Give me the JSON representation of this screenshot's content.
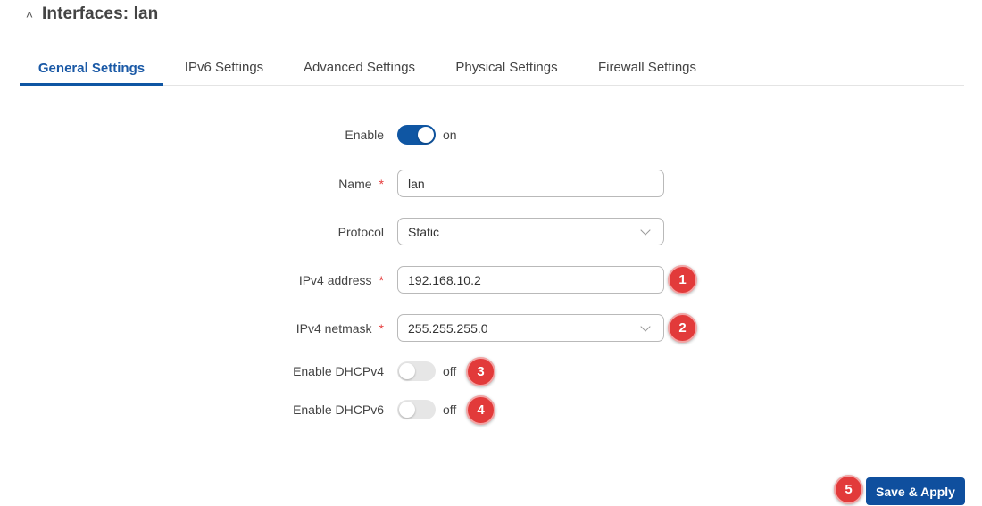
{
  "header": {
    "collapse_icon": "chevron-up-icon",
    "title": "Interfaces: lan"
  },
  "tabs": [
    {
      "label": "General Settings",
      "active": true
    },
    {
      "label": "IPv6 Settings",
      "active": false
    },
    {
      "label": "Advanced Settings",
      "active": false
    },
    {
      "label": "Physical Settings",
      "active": false
    },
    {
      "label": "Firewall Settings",
      "active": false
    }
  ],
  "form": {
    "enable": {
      "label": "Enable",
      "state": "on"
    },
    "name": {
      "label": "Name",
      "required_mark": "*",
      "value": "lan"
    },
    "protocol": {
      "label": "Protocol",
      "value": "Static"
    },
    "ipv4_address": {
      "label": "IPv4 address",
      "required_mark": "*",
      "value": "192.168.10.2"
    },
    "ipv4_netmask": {
      "label": "IPv4 netmask",
      "required_mark": "*",
      "value": "255.255.255.0"
    },
    "dhcpv4": {
      "label": "Enable DHCPv4",
      "state": "off"
    },
    "dhcpv6": {
      "label": "Enable DHCPv6",
      "state": "off"
    }
  },
  "annotations": [
    "1",
    "2",
    "3",
    "4",
    "5"
  ],
  "actions": {
    "save_apply": "Save & Apply"
  },
  "colors": {
    "accent": "#0f56a3",
    "badge": "#e23a3a",
    "required": "#e53a3a"
  }
}
